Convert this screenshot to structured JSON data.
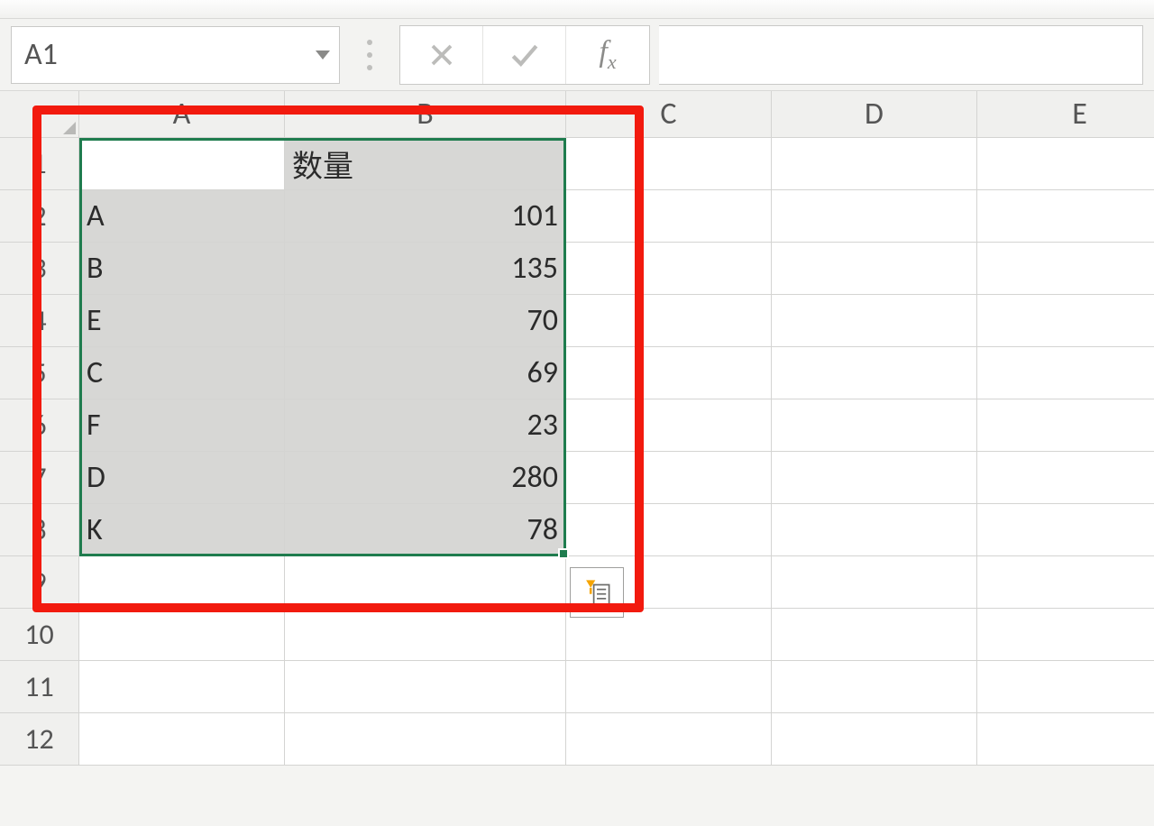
{
  "namebox": {
    "value": "A1"
  },
  "columns": [
    "A",
    "B",
    "C",
    "D",
    "E"
  ],
  "row_numbers": [
    1,
    2,
    3,
    4,
    5,
    6,
    7,
    8,
    9,
    10,
    11,
    12
  ],
  "headers": {
    "a1": "",
    "b1": "数量"
  },
  "rows": [
    {
      "a": "A",
      "b": 101
    },
    {
      "a": "B",
      "b": 135
    },
    {
      "a": "E",
      "b": 70
    },
    {
      "a": "C",
      "b": 69
    },
    {
      "a": "F",
      "b": 23
    },
    {
      "a": "D",
      "b": 280
    },
    {
      "a": "K",
      "b": 78
    }
  ],
  "chart_data": {
    "type": "table",
    "title": "数量",
    "categories": [
      "A",
      "B",
      "E",
      "C",
      "F",
      "D",
      "K"
    ],
    "values": [
      101,
      135,
      70,
      69,
      23,
      280,
      78
    ]
  }
}
